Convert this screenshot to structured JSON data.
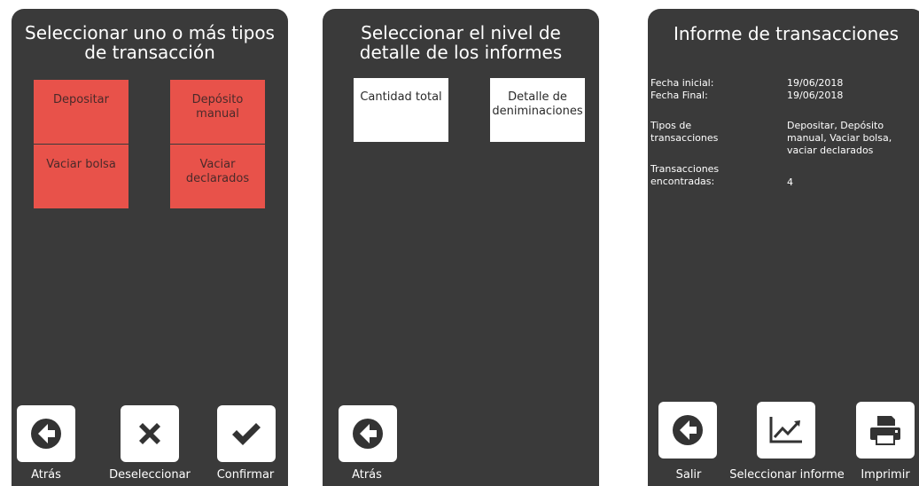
{
  "panel1": {
    "title": "Seleccionar uno o más tipos de transacción",
    "types": [
      "Depositar",
      "Depósito manual",
      "Vaciar bolsa",
      "Vaciar declarados"
    ],
    "buttons": {
      "back": "Atrás",
      "deselect": "Deseleccionar",
      "confirm": "Confirmar"
    }
  },
  "panel2": {
    "title": "Seleccionar el nivel de detalle de los informes",
    "options": [
      "Cantidad total",
      "Detalle de deniminaciones"
    ],
    "buttons": {
      "back": "Atrás"
    }
  },
  "panel3": {
    "title": "Informe de transacciones",
    "rows": [
      {
        "label": "Fecha inicial:",
        "value": "19/06/2018"
      },
      {
        "label": "Fecha Final:",
        "value": "19/06/2018"
      },
      {
        "label": "Tipos de transacciones",
        "value": "Depositar, Depósito manual, Vaciar bolsa, vaciar declarados"
      },
      {
        "label": "Transacciones encontradas:",
        "value": "4"
      }
    ],
    "buttons": {
      "exit": "Salir",
      "select_report": "Seleccionar informe",
      "print": "Imprimir"
    }
  },
  "colors": {
    "panel": "#3a3a3a",
    "tile_red": "#e8524a",
    "tile_white": "#ffffff"
  },
  "icons": [
    "arrow-left-circle-icon",
    "x-icon",
    "check-icon",
    "chart-line-icon",
    "printer-icon"
  ]
}
